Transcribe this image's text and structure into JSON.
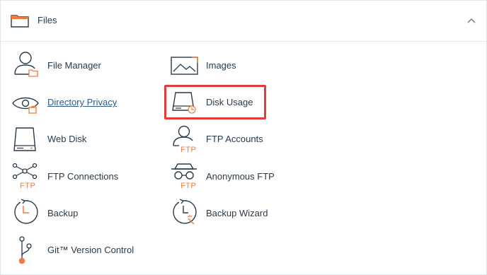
{
  "section": {
    "title": "Files",
    "header_icon": "folder-icon",
    "collapse_icon": "chevron-up-icon"
  },
  "items": [
    {
      "label": "File Manager",
      "icon": "file-manager-icon"
    },
    {
      "label": "Images",
      "icon": "images-icon"
    },
    {
      "label": "Directory Privacy",
      "icon": "directory-privacy-icon"
    },
    {
      "label": "Disk Usage",
      "icon": "disk-usage-icon"
    },
    {
      "label": "Web Disk",
      "icon": "web-disk-icon"
    },
    {
      "label": "FTP Accounts",
      "icon": "ftp-accounts-icon"
    },
    {
      "label": "FTP Connections",
      "icon": "ftp-connections-icon"
    },
    {
      "label": "Anonymous FTP",
      "icon": "anonymous-ftp-icon"
    },
    {
      "label": "Backup",
      "icon": "backup-icon"
    },
    {
      "label": "Backup Wizard",
      "icon": "backup-wizard-icon"
    },
    {
      "label": "Git™ Version Control",
      "icon": "git-version-control-icon"
    }
  ],
  "icon_text": {
    "ftp": "FTP"
  },
  "colors": {
    "accent": "#f17b3c",
    "icon_stroke": "#293a4a",
    "highlight_border": "#e23b3b",
    "link": "#2e5a8c"
  }
}
